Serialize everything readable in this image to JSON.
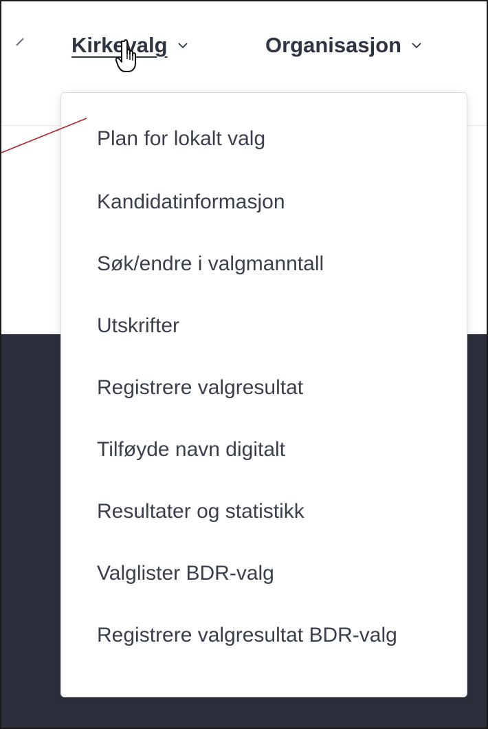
{
  "nav": {
    "items": [
      {
        "label": "Kirkevalg",
        "active": true
      },
      {
        "label": "Organisasjon",
        "active": false
      }
    ]
  },
  "dropdown": {
    "items": [
      {
        "label": "Plan for lokalt valg"
      },
      {
        "label": "Kandidatinformasjon"
      },
      {
        "label": "Søk/endre i valgmanntall"
      },
      {
        "label": "Utskrifter"
      },
      {
        "label": "Registrere valgresultat"
      },
      {
        "label": "Tilføyde navn digitalt"
      },
      {
        "label": "Resultater og statistikk"
      },
      {
        "label": "Valglister BDR-valg"
      },
      {
        "label": "Registrere valgresultat BDR-valg"
      }
    ]
  },
  "icons": {
    "nav_chevron": "chevron-down-icon",
    "left_chevron": "chevron-partial-icon",
    "cursor": "hand-pointer-cursor-icon"
  },
  "colors": {
    "text": "#2e3442",
    "menu_text": "#3a3f4b",
    "dark_background": "#2c2f3b",
    "annotation_line": "#b0232a"
  }
}
